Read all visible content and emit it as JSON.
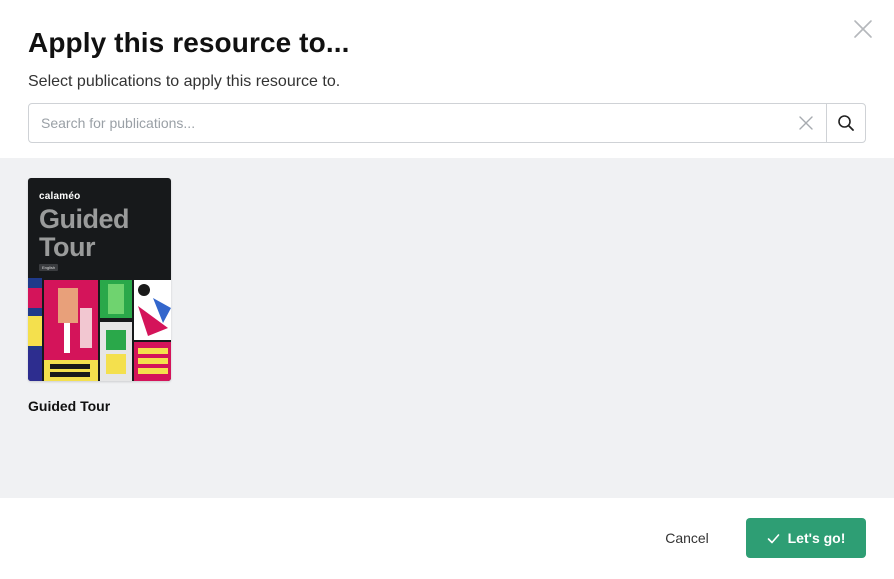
{
  "dialog": {
    "title": "Apply this resource to...",
    "subtitle": "Select publications to apply this resource to."
  },
  "search": {
    "placeholder": "Search for publications...",
    "value": ""
  },
  "icons": {
    "close": "close-icon",
    "clear": "clear-icon",
    "search": "search-icon",
    "check": "check-icon"
  },
  "publications": [
    {
      "title": "Guided Tour",
      "cover": {
        "brand": "calaméo",
        "title_line1": "Guided",
        "title_line2": "Tour",
        "language": "English"
      }
    }
  ],
  "footer": {
    "cancel_label": "Cancel",
    "confirm_label": "Let's go!"
  },
  "colors": {
    "accent": "#2e9e74",
    "content_bg": "#f0f1f3",
    "cover_bg": "#17191b"
  }
}
